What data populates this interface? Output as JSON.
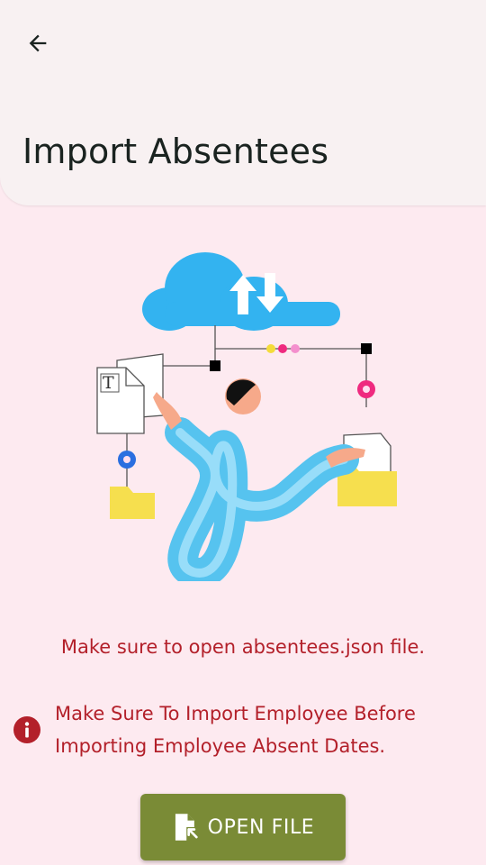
{
  "appbar": {
    "title": "Import Absentees",
    "back_icon": "arrow-back-icon"
  },
  "illustration": {
    "name": "cloud-file-transfer-illustration"
  },
  "messages": {
    "note": "Make sure to open absentees.json file.",
    "warning": "Make Sure To Import Employee Before Importing Employee Absent Dates.",
    "warning_icon": "info-icon"
  },
  "actions": {
    "open_file_label": "OPEN FILE",
    "open_file_icon": "file-open-icon"
  },
  "colors": {
    "background": "#fdeaf0",
    "appbar": "#f8f1f2",
    "error_text": "#b3202a",
    "button": "#7a8b36"
  }
}
